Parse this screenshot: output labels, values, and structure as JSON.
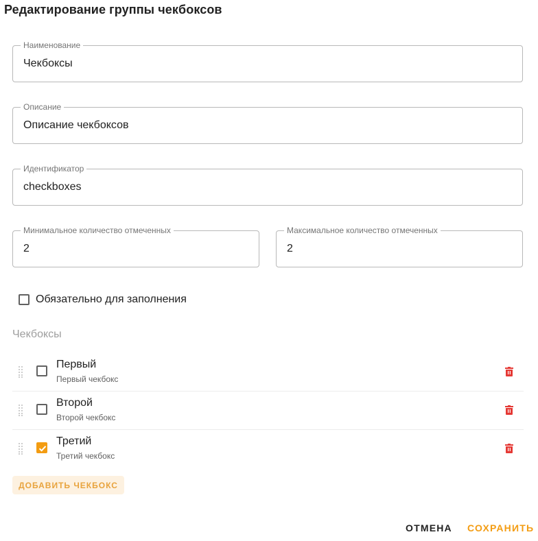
{
  "dialog": {
    "title": "Редактирование группы чекбоксов"
  },
  "fields": {
    "name": {
      "label": "Наименование",
      "value": "Чекбоксы"
    },
    "description": {
      "label": "Описание",
      "value": "Описание чекбоксов"
    },
    "identifier": {
      "label": "Идентификатор",
      "value": "checkboxes"
    },
    "min_checked": {
      "label": "Минимальное количество отмеченных",
      "value": "2"
    },
    "max_checked": {
      "label": "Максимальное количество отмеченных",
      "value": "2"
    }
  },
  "required": {
    "label": "Обязательно для заполнения",
    "checked": false
  },
  "checkboxes_section": {
    "label": "Чекбоксы",
    "items": [
      {
        "title": "Первый",
        "description": "Первый чекбокс",
        "checked": false
      },
      {
        "title": "Второй",
        "description": "Второй чекбокс",
        "checked": false
      },
      {
        "title": "Третий",
        "description": "Третий чекбокс",
        "checked": true
      }
    ],
    "add_label": "ДОБАВИТЬ ЧЕКБОКС"
  },
  "footer": {
    "cancel_label": "ОТМЕНА",
    "save_label": "СОХРАНИТЬ"
  },
  "colors": {
    "accent": "#f39c12",
    "delete": "#e53935"
  },
  "icons": {
    "drag": "drag-handle-icon",
    "delete": "trash-icon",
    "check": "checkmark-icon"
  }
}
